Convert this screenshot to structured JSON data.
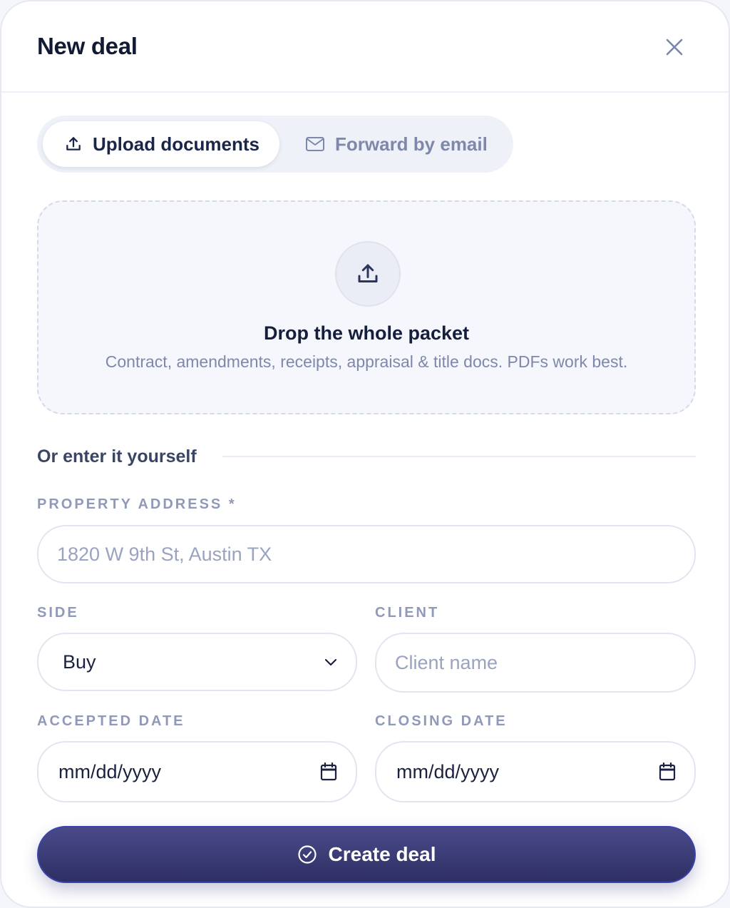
{
  "header": {
    "title": "New deal",
    "close_icon": "close-icon"
  },
  "tabs": [
    {
      "label": "Upload documents",
      "icon": "upload-icon",
      "active": true
    },
    {
      "label": "Forward by email",
      "icon": "mail-icon",
      "active": false
    }
  ],
  "dropzone": {
    "icon": "upload-icon",
    "title": "Drop the whole packet",
    "subtitle": "Contract, amendments, receipts, appraisal & title docs. PDFs work best."
  },
  "manual": {
    "label": "Or enter it yourself"
  },
  "form": {
    "address": {
      "label": "PROPERTY ADDRESS *",
      "placeholder": "1820 W 9th St, Austin TX"
    },
    "side": {
      "label": "SIDE",
      "value": "Buy",
      "icon": "chevron-down-icon"
    },
    "client": {
      "label": "CLIENT",
      "placeholder": "Client name"
    },
    "accepted": {
      "label": "ACCEPTED DATE",
      "value": "mm/dd/yyyy",
      "icon": "calendar-icon"
    },
    "closing": {
      "label": "CLOSING DATE",
      "value": "mm/dd/yyyy",
      "icon": "calendar-icon"
    }
  },
  "create_button": {
    "label": "Create deal",
    "icon": "check-circle-icon"
  },
  "colors": {
    "title": "#111a35",
    "muted": "#7d88ab",
    "button_top": "#4a4a8a",
    "button_bottom": "#2f2f64",
    "border": "#e1e5ef"
  }
}
